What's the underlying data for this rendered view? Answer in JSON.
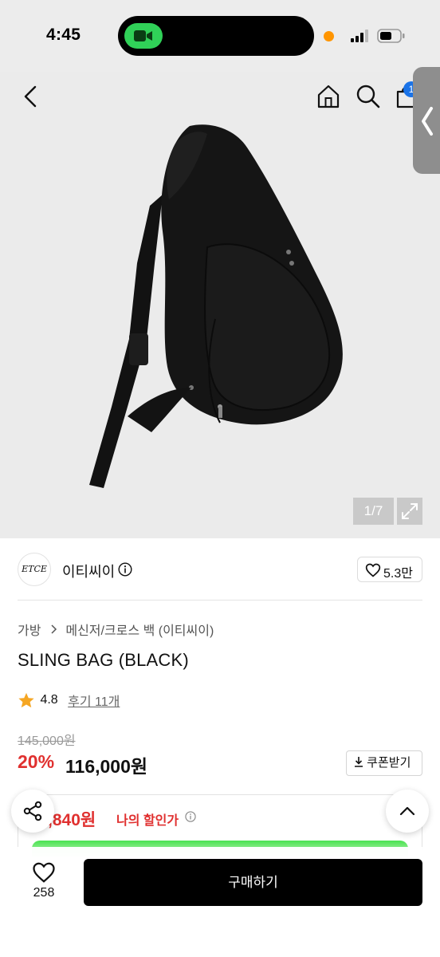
{
  "status_bar": {
    "time": "4:45"
  },
  "gallery": {
    "counter": "1/7",
    "cart_badge": "1"
  },
  "brand": {
    "logo_text": "ETCE",
    "name": "이티씨이",
    "like_count": "5.3만"
  },
  "breadcrumb": {
    "category": "가방",
    "subcategory": "메신저/크로스 백 (이티씨이)"
  },
  "product": {
    "title": "SLING BAG (BLACK)",
    "rating": "4.8",
    "reviews": "후기 11개",
    "original_price": "145,000원",
    "discount_rate": "20%",
    "price": "116,000원",
    "coupon_label": "쿠폰받기",
    "my_price": ",840원",
    "my_price_label": "나의 할인가"
  },
  "bottom_bar": {
    "wish_count": "258",
    "buy_label": "구매하기"
  },
  "colors": {
    "accent_red": "#e0302f",
    "buy_button": "#000000",
    "badge_blue": "#1a73e8",
    "progress_green": "#49e24f"
  }
}
